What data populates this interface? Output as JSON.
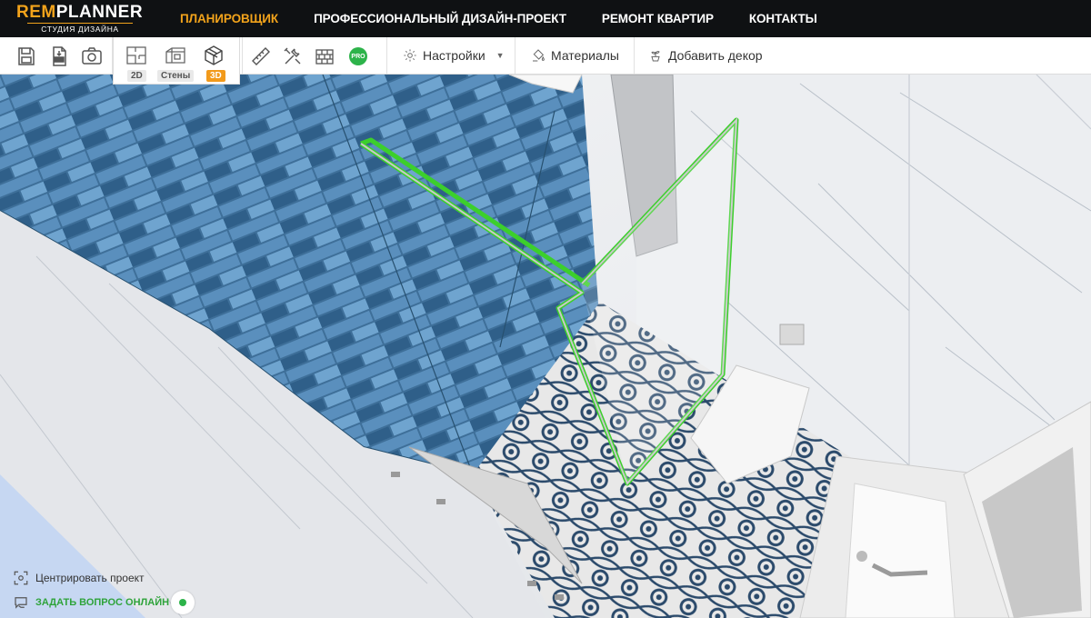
{
  "brand": {
    "name_accent": "REM",
    "name_rest": "PLANNER",
    "tagline": "СТУДИЯ ДИЗАЙНА",
    "accent_color": "#f2a31b"
  },
  "nav": {
    "items": [
      {
        "label": "ПЛАНИРОВЩИК",
        "active": true
      },
      {
        "label": "ПРОФЕССИОНАЛЬНЫЙ ДИЗАЙН-ПРОЕКТ",
        "active": false
      },
      {
        "label": "РЕМОНТ КВАРТИР",
        "active": false
      },
      {
        "label": "КОНТАКТЫ",
        "active": false
      }
    ]
  },
  "toolbar": {
    "icons": [
      "save-icon",
      "export-gltf-icon",
      "camera-icon"
    ],
    "views": [
      {
        "label": "2D",
        "icon": "floorplan-icon",
        "active": false
      },
      {
        "label": "Стены",
        "icon": "walls-icon",
        "active": false
      },
      {
        "label": "3D",
        "icon": "cube-3d-icon",
        "active": true
      }
    ],
    "tools": [
      "ruler-icon",
      "tools-icon",
      "brick-wall-icon"
    ],
    "pro_label": "PRO",
    "settings_label": "Настройки",
    "materials_label": "Материалы",
    "decor_label": "Добавить декор"
  },
  "bottom_left": {
    "center_label": "Центрировать проект",
    "ask_label": "ЗАДАТЬ ВОПРОС ОНЛАЙН",
    "online_color": "#2db34a"
  },
  "scene": {
    "selection_color": "#3ccf2c",
    "tile_color": "#3d6f98",
    "floor_pattern_color": "#2b4a6b"
  }
}
